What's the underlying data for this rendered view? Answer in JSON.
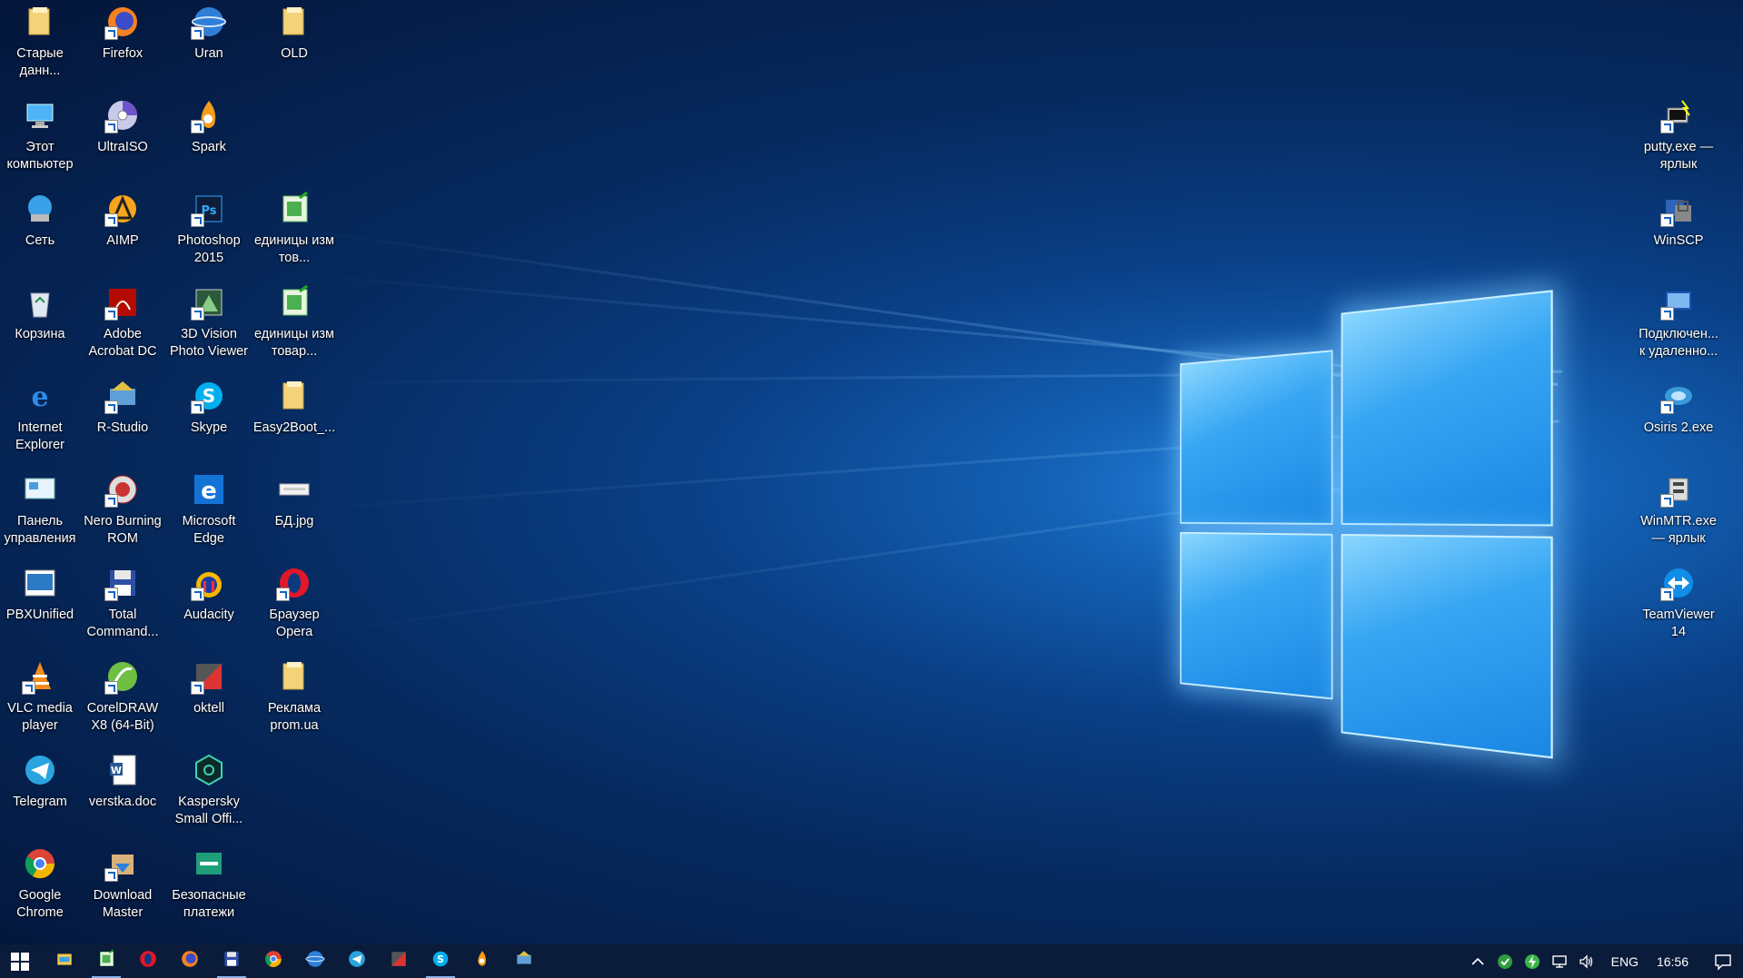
{
  "desktop_icons": [
    {
      "id": "old-data",
      "label": "Старые данн...",
      "icon": "folder-icon",
      "col": 0,
      "row": 0,
      "shortcut": false
    },
    {
      "id": "this-pc",
      "label": "Этот компьютер",
      "icon": "computer-icon",
      "col": 0,
      "row": 1,
      "shortcut": false
    },
    {
      "id": "network",
      "label": "Сеть",
      "icon": "network-icon",
      "col": 0,
      "row": 2,
      "shortcut": false
    },
    {
      "id": "recycle-bin",
      "label": "Корзина",
      "icon": "recycle-bin-icon",
      "col": 0,
      "row": 3,
      "shortcut": false
    },
    {
      "id": "internet-explorer",
      "label": "Internet Explorer",
      "icon": "internet-explorer-icon",
      "col": 0,
      "row": 4,
      "shortcut": false
    },
    {
      "id": "control-panel",
      "label": "Панель управления",
      "icon": "control-panel-icon",
      "col": 0,
      "row": 5,
      "shortcut": false
    },
    {
      "id": "pbxunified",
      "label": "PBXUnified",
      "icon": "pbx-icon",
      "col": 0,
      "row": 6,
      "shortcut": false
    },
    {
      "id": "vlc",
      "label": "VLC media player",
      "icon": "vlc-icon",
      "col": 0,
      "row": 7,
      "shortcut": true
    },
    {
      "id": "telegram",
      "label": "Telegram",
      "icon": "telegram-icon",
      "col": 0,
      "row": 8,
      "shortcut": false
    },
    {
      "id": "chrome",
      "label": "Google Chrome",
      "icon": "chrome-icon",
      "col": 0,
      "row": 9,
      "shortcut": false
    },
    {
      "id": "firefox",
      "label": "Firefox",
      "icon": "firefox-icon",
      "col": 1,
      "row": 0,
      "shortcut": true
    },
    {
      "id": "ultraiso",
      "label": "UltraISO",
      "icon": "disc-icon",
      "col": 1,
      "row": 1,
      "shortcut": true
    },
    {
      "id": "aimp",
      "label": "AIMP",
      "icon": "aimp-icon",
      "col": 1,
      "row": 2,
      "shortcut": true
    },
    {
      "id": "acrobat",
      "label": "Adobe Acrobat DC",
      "icon": "acrobat-icon",
      "col": 1,
      "row": 3,
      "shortcut": true
    },
    {
      "id": "r-studio",
      "label": "R-Studio",
      "icon": "r-studio-icon",
      "col": 1,
      "row": 4,
      "shortcut": true
    },
    {
      "id": "nero",
      "label": "Nero Burning ROM",
      "icon": "nero-icon",
      "col": 1,
      "row": 5,
      "shortcut": true
    },
    {
      "id": "total-commander",
      "label": "Total Command...",
      "icon": "floppy-icon",
      "col": 1,
      "row": 6,
      "shortcut": true
    },
    {
      "id": "coreldraw",
      "label": "CorelDRAW X8 (64-Bit)",
      "icon": "corel-icon",
      "col": 1,
      "row": 7,
      "shortcut": true
    },
    {
      "id": "verstka",
      "label": "verstka.doc",
      "icon": "word-doc-icon",
      "col": 1,
      "row": 8,
      "shortcut": false
    },
    {
      "id": "download-master",
      "label": "Download Master",
      "icon": "download-icon",
      "col": 1,
      "row": 9,
      "shortcut": true
    },
    {
      "id": "uran",
      "label": "Uran",
      "icon": "uran-icon",
      "col": 2,
      "row": 0,
      "shortcut": true
    },
    {
      "id": "spark",
      "label": "Spark",
      "icon": "spark-icon",
      "col": 2,
      "row": 1,
      "shortcut": true
    },
    {
      "id": "photoshop",
      "label": "Photoshop 2015",
      "icon": "photoshop-icon",
      "col": 2,
      "row": 2,
      "shortcut": true
    },
    {
      "id": "3d-vision",
      "label": "3D Vision Photo Viewer",
      "icon": "3d-vision-icon",
      "col": 2,
      "row": 3,
      "shortcut": true
    },
    {
      "id": "skype",
      "label": "Skype",
      "icon": "skype-icon",
      "col": 2,
      "row": 4,
      "shortcut": true
    },
    {
      "id": "edge",
      "label": "Microsoft Edge",
      "icon": "edge-icon",
      "col": 2,
      "row": 5,
      "shortcut": false
    },
    {
      "id": "audacity",
      "label": "Audacity",
      "icon": "audacity-icon",
      "col": 2,
      "row": 6,
      "shortcut": true
    },
    {
      "id": "oktell",
      "label": "oktell",
      "icon": "oktell-icon",
      "col": 2,
      "row": 7,
      "shortcut": true
    },
    {
      "id": "kaspersky",
      "label": "Kaspersky Small Offi...",
      "icon": "kaspersky-icon",
      "col": 2,
      "row": 8,
      "shortcut": false
    },
    {
      "id": "safe-payments",
      "label": "Безопасные платежи",
      "icon": "safe-payments-icon",
      "col": 2,
      "row": 9,
      "shortcut": false
    },
    {
      "id": "old",
      "label": "OLD",
      "icon": "folder-icon",
      "col": 3,
      "row": 0,
      "shortcut": false
    },
    {
      "id": "units-1",
      "label": "единицы изм тов...",
      "icon": "spreadsheet-icon",
      "col": 3,
      "row": 2,
      "shortcut": false
    },
    {
      "id": "units-2",
      "label": "единицы изм товар...",
      "icon": "spreadsheet-icon",
      "col": 3,
      "row": 3,
      "shortcut": false
    },
    {
      "id": "easy2boot",
      "label": "Easy2Boot_...",
      "icon": "folder-icon",
      "col": 3,
      "row": 4,
      "shortcut": false
    },
    {
      "id": "bd-jpg",
      "label": "БД.jpg",
      "icon": "image-file-icon",
      "col": 3,
      "row": 5,
      "shortcut": false
    },
    {
      "id": "opera",
      "label": "Браузер Opera",
      "icon": "opera-icon",
      "col": 3,
      "row": 6,
      "shortcut": true
    },
    {
      "id": "prom-ads",
      "label": "Реклама prom.ua",
      "icon": "folder-icon",
      "col": 3,
      "row": 7,
      "shortcut": false
    }
  ],
  "right_icons": [
    {
      "id": "putty",
      "label": "putty.exe — ярлык",
      "icon": "putty-icon",
      "row": 1,
      "shortcut": true
    },
    {
      "id": "winscp",
      "label": "WinSCP",
      "icon": "winscp-icon",
      "row": 2,
      "shortcut": true
    },
    {
      "id": "rdp",
      "label": "Подключен... к удаленно...",
      "icon": "remote-desktop-icon",
      "row": 3,
      "shortcut": true
    },
    {
      "id": "osiris",
      "label": "Osiris 2.exe",
      "icon": "osiris-icon",
      "row": 4,
      "shortcut": true
    },
    {
      "id": "winmtr",
      "label": "WinMTR.exe — ярлык",
      "icon": "winmtr-icon",
      "row": 5,
      "shortcut": true
    },
    {
      "id": "teamviewer",
      "label": "TeamViewer 14",
      "icon": "teamviewer-icon",
      "row": 6,
      "shortcut": true
    }
  ],
  "taskbar": {
    "apps": [
      {
        "id": "explorer",
        "icon": "file-explorer-icon",
        "active": false
      },
      {
        "id": "spreadsheet",
        "icon": "spreadsheet-icon",
        "active": true
      },
      {
        "id": "opera",
        "icon": "opera-icon",
        "active": false
      },
      {
        "id": "firefox",
        "icon": "firefox-icon",
        "active": false
      },
      {
        "id": "total-commander",
        "icon": "floppy-icon",
        "active": true
      },
      {
        "id": "chrome",
        "icon": "chrome-icon",
        "active": false
      },
      {
        "id": "uran",
        "icon": "uran-icon",
        "active": false
      },
      {
        "id": "telegram",
        "icon": "telegram-icon",
        "active": false
      },
      {
        "id": "oktell",
        "icon": "oktell-icon",
        "active": false
      },
      {
        "id": "skype",
        "icon": "skype-icon",
        "active": true
      },
      {
        "id": "spark",
        "icon": "spark-icon",
        "active": false
      },
      {
        "id": "r-studio",
        "icon": "r-studio-icon",
        "active": false
      }
    ],
    "language": "ENG",
    "time": "16:56"
  }
}
